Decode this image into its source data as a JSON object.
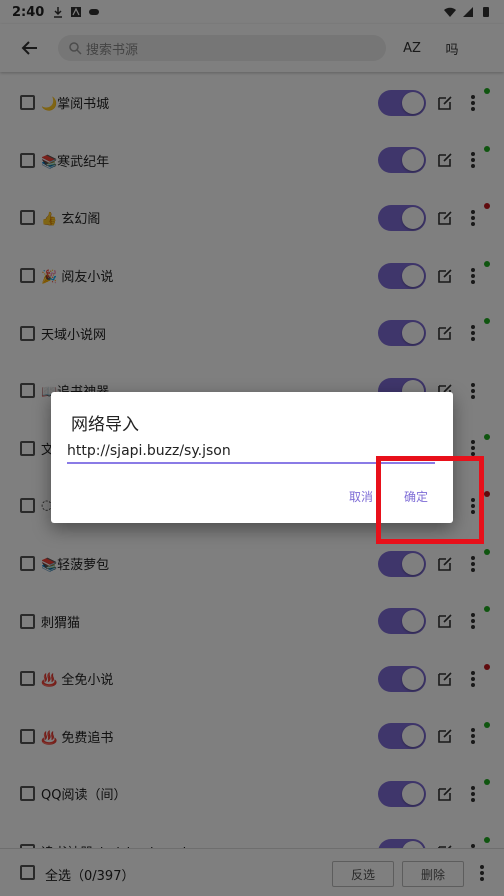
{
  "status_bar": {
    "time": "2:40"
  },
  "toolbar": {
    "search_placeholder": "搜索书源",
    "sort_label": "AZ",
    "group_label": "吗"
  },
  "sources": [
    {
      "name": "🌙掌阅书城",
      "enabled": true,
      "status_color": "#1faa1f"
    },
    {
      "name": "📚寒武纪年",
      "enabled": true,
      "status_color": "#1faa1f"
    },
    {
      "name": "👍 玄幻阁",
      "enabled": true,
      "status_color": "#c0161c"
    },
    {
      "name": "🎉 阅友小说",
      "enabled": true,
      "status_color": "#1faa1f"
    },
    {
      "name": "天域小说网",
      "enabled": true,
      "status_color": "#1faa1f"
    },
    {
      "name": "📖追书神器",
      "enabled": true,
      "status_color": ""
    },
    {
      "name": "文",
      "enabled": true,
      "status_color": "#1faa1f"
    },
    {
      "name": "◌",
      "enabled": true,
      "status_color": "#c0161c"
    },
    {
      "name": "📚轻菠萝包",
      "enabled": true,
      "status_color": "#1faa1f"
    },
    {
      "name": "刺猬猫",
      "enabled": true,
      "status_color": "#1faa1f"
    },
    {
      "name": "♨️ 全免小说",
      "enabled": true,
      "status_color": "#c0161c"
    },
    {
      "name": "♨️ 免费追书",
      "enabled": true,
      "status_color": "#1faa1f"
    },
    {
      "name": "QQ阅读（间）",
      "enabled": true,
      "status_color": "#1faa1f"
    },
    {
      "name": "追书神器zhuishushenqi",
      "enabled": true,
      "status_color": "#1faa1f"
    }
  ],
  "bottom_bar": {
    "select_all_label": "全选（0/397）",
    "invert_label": "反选",
    "delete_label": "删除"
  },
  "dialog": {
    "title": "网络导入",
    "url_value": "http://sjapi.buzz/sy.json",
    "cancel_label": "取消",
    "ok_label": "确定"
  },
  "colors": {
    "accent": "#7e6cd6",
    "highlight": "#e8101a"
  }
}
